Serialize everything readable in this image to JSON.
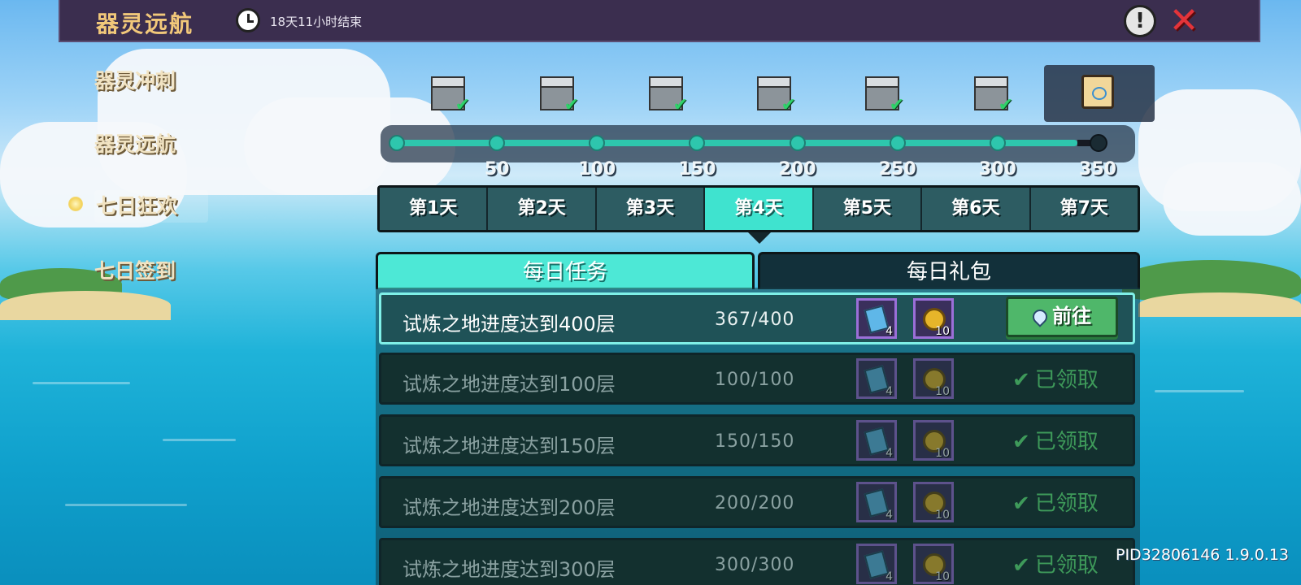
{
  "header": {
    "title": "器灵远航",
    "timer": "18天11小时结束"
  },
  "sidebar": {
    "items": [
      {
        "label": "器灵冲刺"
      },
      {
        "label": "器灵远航"
      },
      {
        "label": "七日狂欢"
      },
      {
        "label": "七日签到"
      }
    ]
  },
  "progress": {
    "ticks": [
      "50",
      "100",
      "150",
      "200",
      "250",
      "300",
      "350"
    ],
    "current": 340,
    "max": 350
  },
  "day_tabs": [
    "第1天",
    "第2天",
    "第3天",
    "第4天",
    "第5天",
    "第6天",
    "第7天"
  ],
  "panel_tabs": {
    "daily_tasks": "每日任务",
    "daily_gift": "每日礼包"
  },
  "tasks": [
    {
      "name": "试炼之地进度达到400层",
      "progress": "367/400",
      "reward1_qty": "4",
      "reward2_qty": "10",
      "action": "前往"
    },
    {
      "name": "试炼之地进度达到100层",
      "progress": "100/100",
      "reward1_qty": "4",
      "reward2_qty": "10",
      "action": "已领取"
    },
    {
      "name": "试炼之地进度达到150层",
      "progress": "150/150",
      "reward1_qty": "4",
      "reward2_qty": "10",
      "action": "已领取"
    },
    {
      "name": "试炼之地进度达到200层",
      "progress": "200/200",
      "reward1_qty": "4",
      "reward2_qty": "10",
      "action": "已领取"
    },
    {
      "name": "试炼之地进度达到300层",
      "progress": "300/300",
      "reward1_qty": "4",
      "reward2_qty": "10",
      "action": "已领取"
    }
  ],
  "version": "PID32806146 1.9.0.13",
  "colors": {
    "accent": "#3fe3cf",
    "go_button": "#4fb76a",
    "claimed": "#3e9a5a",
    "title": "#f1c87a"
  }
}
